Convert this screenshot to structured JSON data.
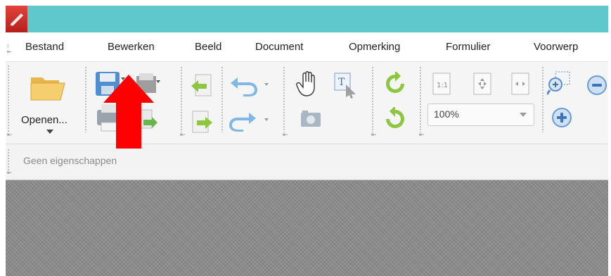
{
  "menu": {
    "items": [
      "Bestand",
      "Bewerken",
      "Beeld",
      "Document",
      "Opmerking",
      "Formulier",
      "Voorwerp"
    ]
  },
  "toolbar": {
    "open_label": "Openen...",
    "zoom_value": "100%"
  },
  "properties": {
    "label": "Geen eigenschappen"
  },
  "colors": {
    "titlebar": "#5ec8cd",
    "annotation_arrow": "#ff0000",
    "workspace": "#8c8c8c"
  },
  "icons": [
    "app-logo-icon",
    "open-folder-icon",
    "save-icon",
    "print-icon",
    "page-back-icon",
    "page-forward-icon",
    "undo-icon",
    "redo-icon",
    "hand-tool-icon",
    "select-text-icon",
    "snapshot-icon",
    "rotate-left-icon",
    "rotate-right-icon",
    "actual-size-icon",
    "fit-page-icon",
    "fit-width-icon",
    "zoom-in-marquee-icon",
    "zoom-out-icon",
    "zoom-in-icon",
    "red-up-arrow"
  ]
}
